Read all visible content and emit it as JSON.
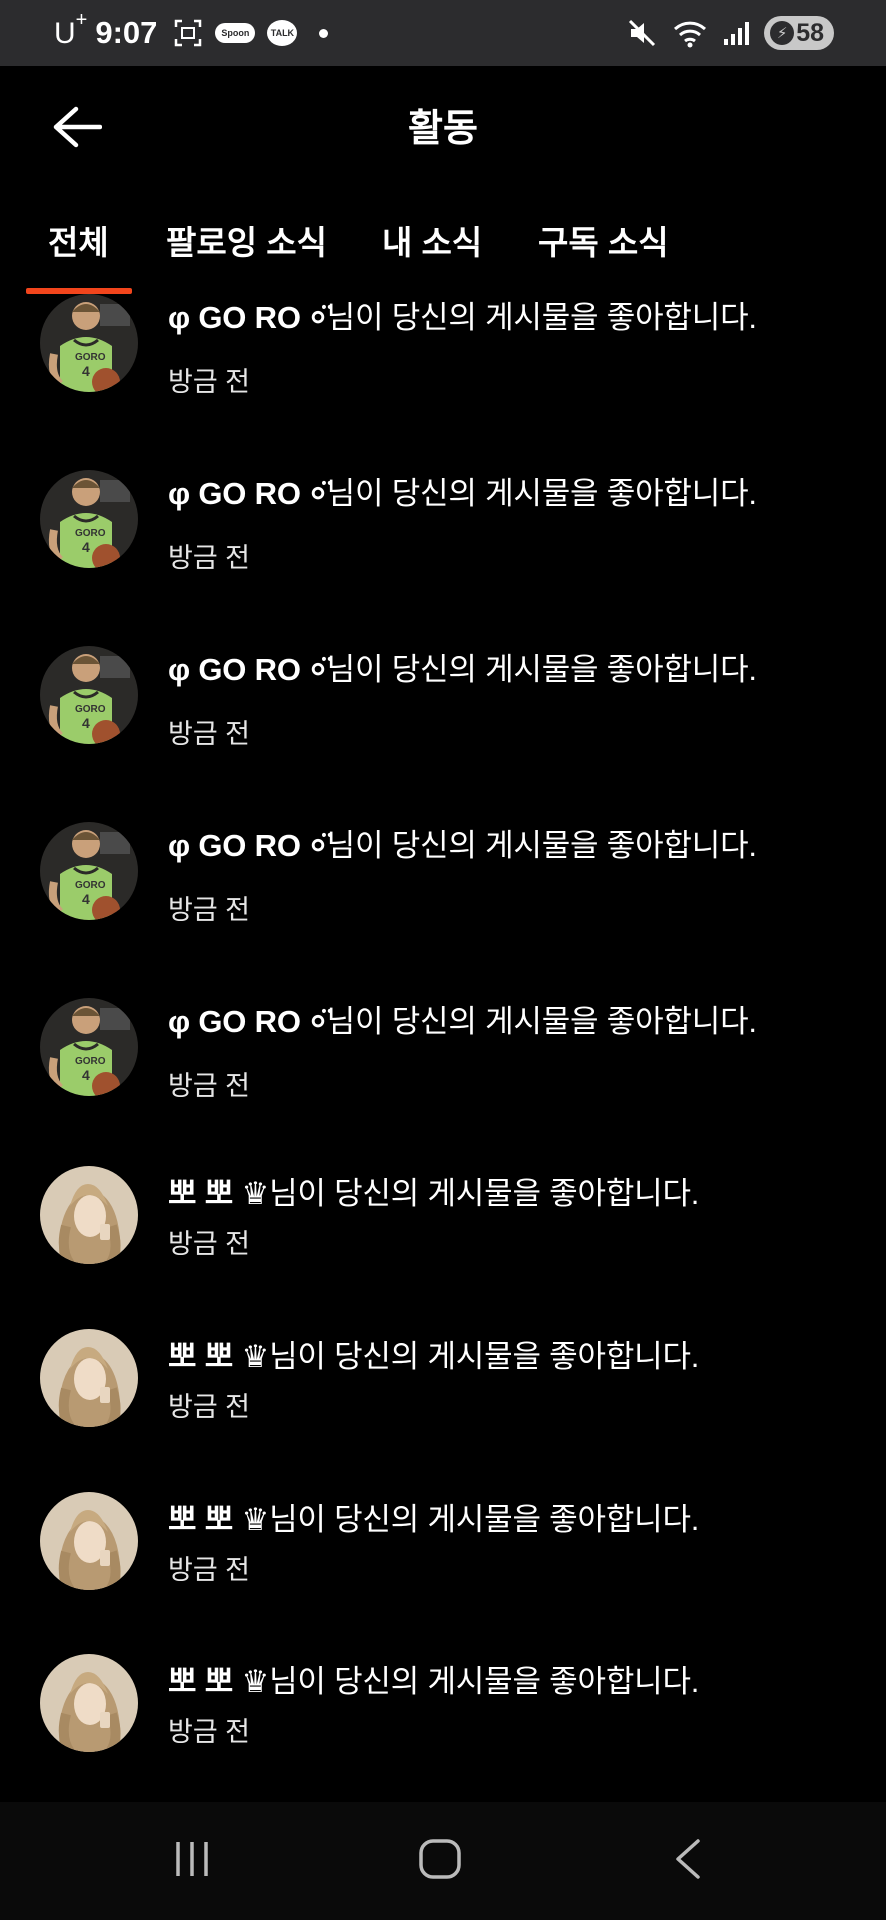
{
  "status_bar": {
    "carrier": "U",
    "carrier_sup": "+",
    "time": "9:07",
    "spoon_label": "Spoon",
    "talk_label": "TALK",
    "battery": "58"
  },
  "header": {
    "title": "활동"
  },
  "tabs": [
    {
      "label": "전체",
      "active": true
    },
    {
      "label": "팔로잉 소식",
      "active": false
    },
    {
      "label": "내 소식",
      "active": false
    },
    {
      "label": "구독 소식",
      "active": false
    }
  ],
  "accent_color": "#f2451c",
  "notifications": [
    {
      "avatar": "basketball-player",
      "name": "φ GO RO ⸰̈",
      "suffix": "님이 당신의 게시물을 좋아합니다.",
      "time": "방금 전"
    },
    {
      "avatar": "basketball-player",
      "name": "φ GO RO ⸰̈",
      "suffix": "님이 당신의 게시물을 좋아합니다.",
      "time": "방금 전"
    },
    {
      "avatar": "basketball-player",
      "name": "φ GO RO ⸰̈",
      "suffix": "님이 당신의 게시물을 좋아합니다.",
      "time": "방금 전"
    },
    {
      "avatar": "basketball-player",
      "name": "φ GO RO ⸰̈",
      "suffix": "님이 당신의 게시물을 좋아합니다.",
      "time": "방금 전"
    },
    {
      "avatar": "basketball-player",
      "name": "φ GO RO ⸰̈",
      "suffix": "님이 당신의 게시물을 좋아합니다.",
      "time": "방금 전"
    },
    {
      "avatar": "blonde-woman",
      "name": "뽀 뽀 ♛",
      "suffix": "님이 당신의 게시물을 좋아합니다.",
      "time": "방금 전"
    },
    {
      "avatar": "blonde-woman",
      "name": "뽀 뽀 ♛",
      "suffix": "님이 당신의 게시물을 좋아합니다.",
      "time": "방금 전"
    },
    {
      "avatar": "blonde-woman",
      "name": "뽀 뽀 ♛",
      "suffix": "님이 당신의 게시물을 좋아합니다.",
      "time": "방금 전"
    },
    {
      "avatar": "blonde-woman",
      "name": "뽀 뽀 ♛",
      "suffix": "님이 당신의 게시물을 좋아합니다.",
      "time": "방금 전"
    }
  ],
  "nav": {
    "recents_icon": "recents-icon",
    "home_icon": "home-icon",
    "back_icon": "back-icon"
  }
}
